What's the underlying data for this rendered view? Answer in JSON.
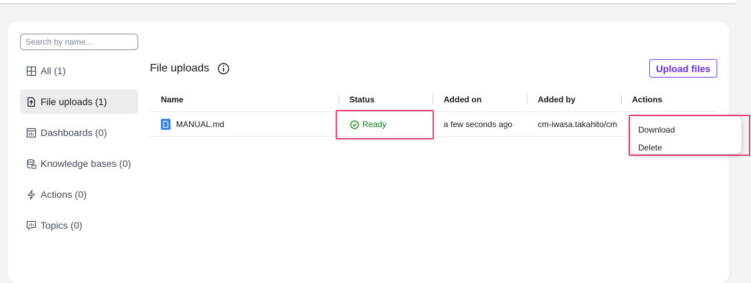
{
  "search": {
    "placeholder": "Search by name..."
  },
  "sidebar": {
    "items": [
      {
        "label": "All (1)",
        "icon": "grid-icon",
        "active": false
      },
      {
        "label": "File uploads (1)",
        "icon": "file-upload-icon",
        "active": true
      },
      {
        "label": "Dashboards (0)",
        "icon": "dashboard-icon",
        "active": false
      },
      {
        "label": "Knowledge bases (0)",
        "icon": "database-icon",
        "active": false
      },
      {
        "label": "Actions (0)",
        "icon": "lightning-icon",
        "active": false
      },
      {
        "label": "Topics (0)",
        "icon": "topic-chat-icon",
        "active": false
      }
    ]
  },
  "main": {
    "title": "File uploads",
    "upload_button": "Upload files",
    "columns": [
      "Name",
      "Status",
      "Added on",
      "Added by",
      "Actions"
    ],
    "rows": [
      {
        "name": "MANUAL.md",
        "status": "Ready",
        "added_on": "a few seconds ago",
        "added_by": "cm-iwasa.takahito/cm"
      }
    ]
  },
  "actions_menu": {
    "items": [
      "Download",
      "Delete"
    ]
  },
  "colors": {
    "accent": "#7d3cf0",
    "status_ready": "#037f0c",
    "highlight": "#e83e73",
    "active_nav_bg": "#ececee"
  }
}
